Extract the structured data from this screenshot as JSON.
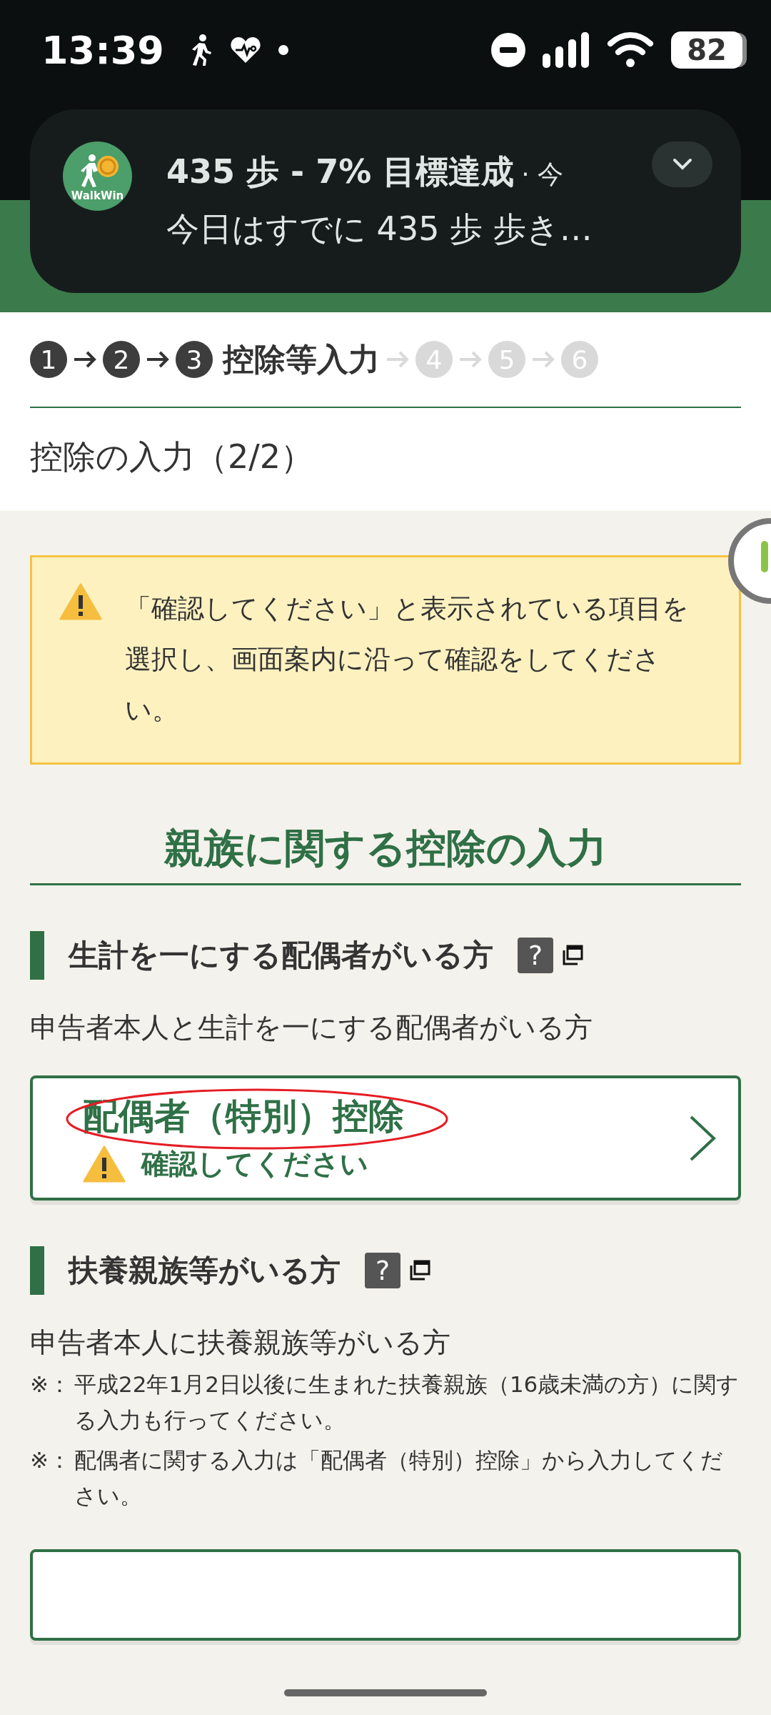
{
  "status_bar": {
    "time": "13:39",
    "battery": "82"
  },
  "notification": {
    "app_label": "WalkWin",
    "title": "435 歩 - 7% 目標達成",
    "time": "· 今",
    "text": "今日はすでに 435 歩 歩き…"
  },
  "steps": [
    {
      "number": "1",
      "kind": "done"
    },
    {
      "number": "2",
      "kind": "done"
    },
    {
      "number": "3",
      "kind": "current",
      "label": "控除等入力"
    },
    {
      "number": "4",
      "kind": "upcoming"
    },
    {
      "number": "5",
      "kind": "upcoming"
    },
    {
      "number": "6",
      "kind": "upcoming"
    }
  ],
  "page_title": "控除の入力（2/2）",
  "notice": "「確認してください」と表示されている項目を選択し、画面案内に沿って確認をしてください。",
  "section_heading": "親族に関する控除の入力",
  "groups": [
    {
      "heading": "生計を一にする配偶者がいる方",
      "help_label": "?",
      "description": "申告者本人と生計を一にする配偶者がいる方",
      "card": {
        "title": "配偶者（特別）控除",
        "status": "確認してください",
        "circled": true
      }
    },
    {
      "heading": "扶養親族等がいる方",
      "help_label": "?",
      "description": "申告者本人に扶養親族等がいる方",
      "notes": [
        {
          "mark": "※：",
          "text": "平成22年1月2日以後に生まれた扶養親族（16歳未満の方）に関する入力も行ってください。"
        },
        {
          "mark": "※：",
          "text": "配偶者に関する入力は「配偶者（特別）控除」から入力してください。"
        }
      ]
    }
  ]
}
